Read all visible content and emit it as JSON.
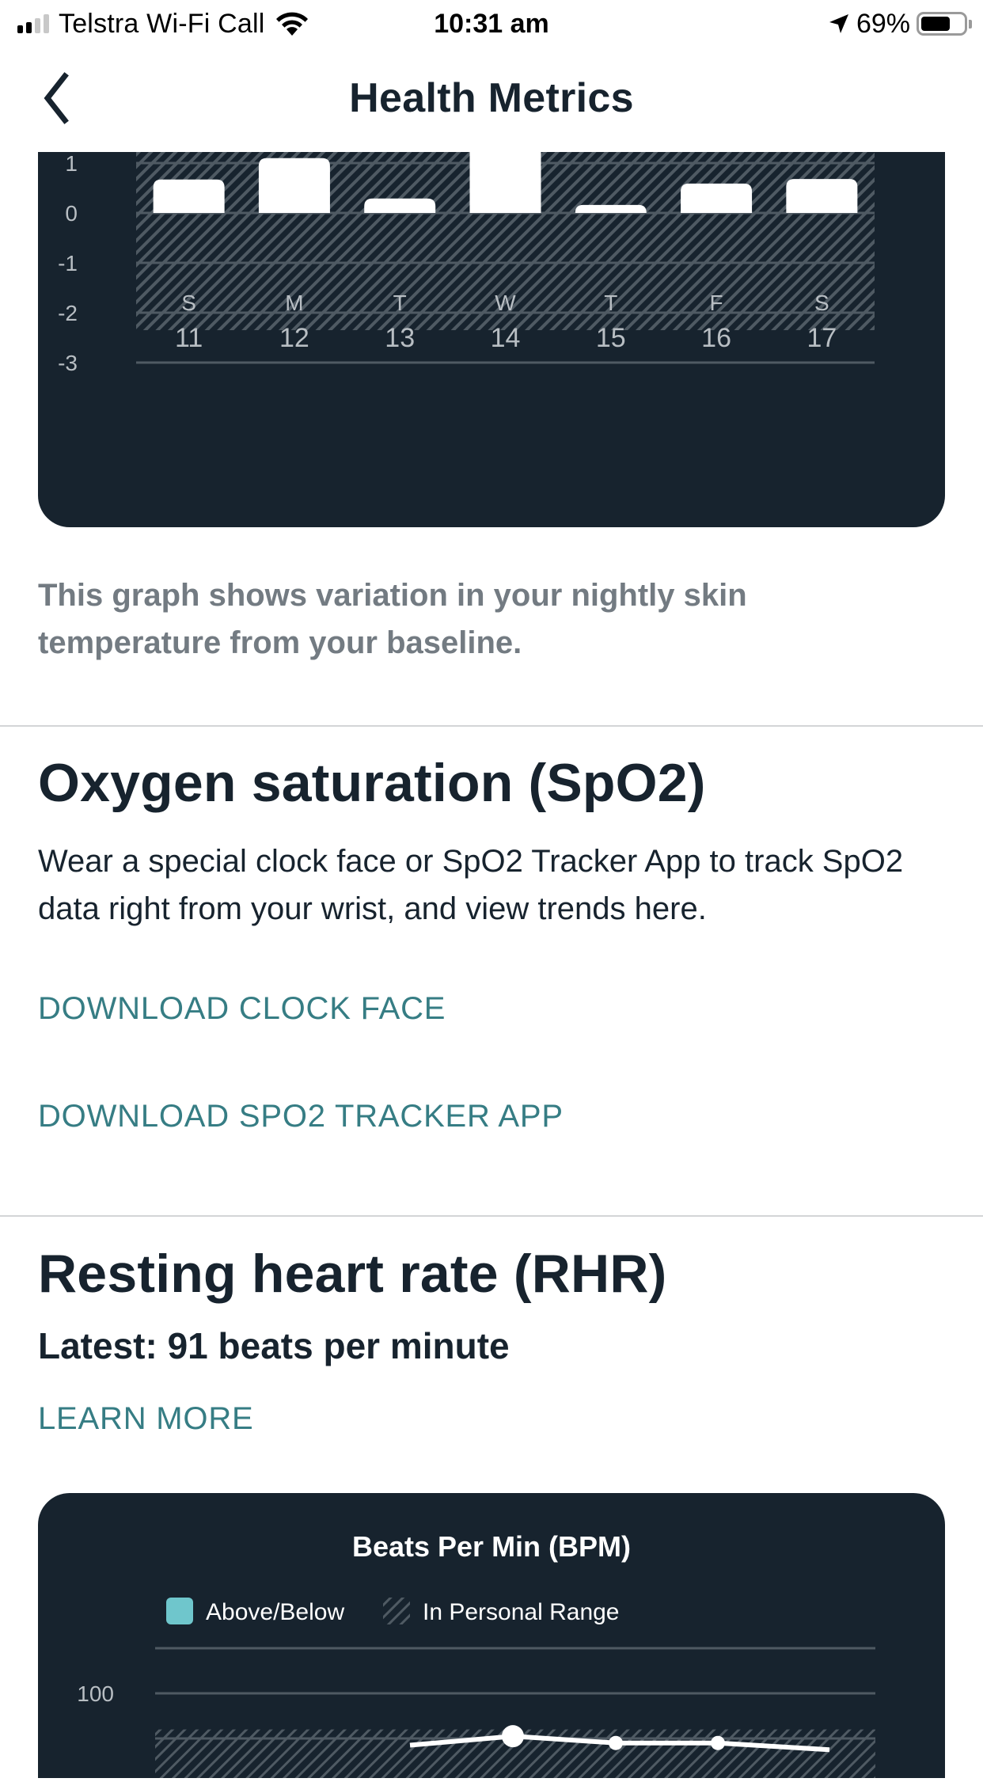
{
  "status_bar": {
    "carrier": "Telstra Wi-Fi Call",
    "time": "10:31 am",
    "battery_percent_text": "69%",
    "battery_level": 0.69,
    "signal_bars_active": 2,
    "signal_bars_total": 4,
    "icons": [
      "signal-icon",
      "wifi-icon",
      "location-arrow-icon",
      "battery-icon"
    ]
  },
  "header": {
    "title": "Health Metrics",
    "back_icon": "chevron-left-icon"
  },
  "skin_temperature": {
    "caption": "This graph shows variation in your nightly skin temperature from your baseline."
  },
  "spo2": {
    "title": "Oxygen saturation (SpO2)",
    "description": "Wear a special clock face or SpO2 Tracker App to track SpO2 data right from your wrist, and view trends here.",
    "download_clock_face": "DOWNLOAD CLOCK FACE",
    "download_tracker_app": "DOWNLOAD SPO2 TRACKER APP"
  },
  "rhr": {
    "title": "Resting heart rate (RHR)",
    "latest": "Latest: 91 beats per minute",
    "learn_more": "LEARN MORE"
  },
  "colors": {
    "card_bg": "#17232e",
    "accent_teal": "#367d84",
    "legend_teal": "#6fc6cc",
    "hatch": "#4f5a63",
    "grid": "#4f5a63",
    "bar": "#ffffff"
  },
  "chart_data": [
    {
      "type": "bar",
      "title": "",
      "xlabel": "",
      "ylabel": "",
      "categories": [
        "S 11",
        "M 12",
        "T 13",
        "W 14",
        "T 15",
        "F 16",
        "S 17"
      ],
      "day_letters": [
        "S",
        "M",
        "T",
        "W",
        "T",
        "F",
        "S"
      ],
      "day_numbers": [
        "11",
        "12",
        "13",
        "14",
        "15",
        "16",
        "17"
      ],
      "values": [
        0.67,
        1.1,
        0.29,
        1.6,
        0.16,
        0.59,
        0.68
      ],
      "y_ticks": [
        "1",
        "0",
        "-1",
        "-2",
        "-3"
      ],
      "y_tick_values": [
        1,
        0,
        -1,
        -2,
        -3
      ],
      "ylim_visible": [
        -3.3,
        1.3
      ],
      "personal_range": [
        -2.35,
        1.3
      ],
      "grid": true,
      "note": "top of chart clipped by header; W 14 bar extends beyond visible area"
    },
    {
      "type": "line",
      "title": "Beats Per Min (BPM)",
      "legend": [
        {
          "label": "Above/Below",
          "swatch": "solid-teal"
        },
        {
          "label": "In Personal Range",
          "swatch": "hatched"
        }
      ],
      "legend_position": "top-left",
      "y_ticks": [
        "100"
      ],
      "y_tick_values": [
        100
      ],
      "grid_values": [
        110,
        100,
        90
      ],
      "personal_range_upper": 92,
      "points_visible": [
        90.5,
        89,
        89
      ],
      "grid": true,
      "note": "chart cut off at bottom of screen; only top of series visible"
    }
  ]
}
